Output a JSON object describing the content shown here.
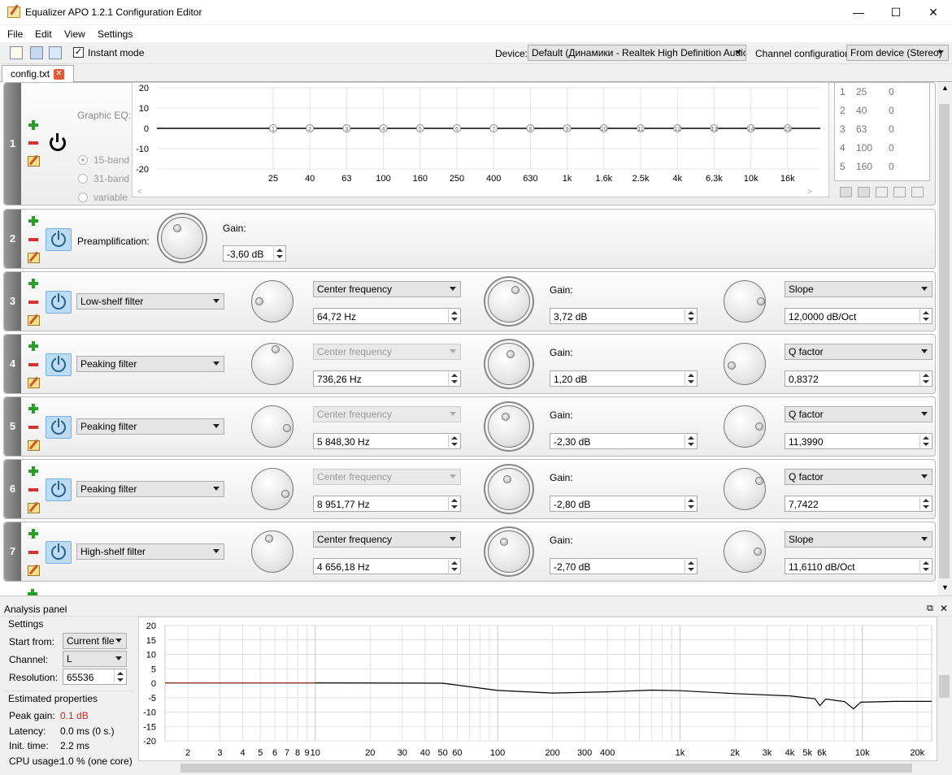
{
  "window": {
    "title": "Equalizer APO 1.2.1 Configuration Editor",
    "minimize": "—",
    "maximize": "☐",
    "close": "✕"
  },
  "menu": [
    "File",
    "Edit",
    "View",
    "Settings"
  ],
  "toolbar": {
    "instant_mode_label": "Instant mode",
    "instant_mode_checked": true,
    "device_label": "Device:",
    "device_value": "Default (Динамики - Realtek High Definition Audio)",
    "channel_label": "Channel configuration:",
    "channel_value": "From device (Stereo)"
  },
  "tab": {
    "label": "config.txt",
    "close": "✕"
  },
  "geq": {
    "number": "1",
    "label": "Graphic EQ:",
    "modes": [
      "15-band",
      "31-band",
      "variable"
    ],
    "selected_mode": "15-band",
    "y_ticks": [
      "20",
      "10",
      "0",
      "-10",
      "-20"
    ],
    "freq_labels": [
      "25",
      "40",
      "63",
      "100",
      "160",
      "250",
      "400",
      "630",
      "1k",
      "1.6k",
      "2.5k",
      "4k",
      "6.3k",
      "10k",
      "16k"
    ],
    "nodes": [
      "1",
      "2",
      "3",
      "4",
      "5",
      "6",
      "7",
      "8",
      "9",
      "10",
      "11",
      "12",
      "13",
      "14",
      "15"
    ],
    "table": [
      [
        "1",
        "25",
        "0"
      ],
      [
        "2",
        "40",
        "0"
      ],
      [
        "3",
        "63",
        "0"
      ],
      [
        "4",
        "100",
        "0"
      ],
      [
        "5",
        "160",
        "0"
      ]
    ]
  },
  "preamp": {
    "number": "2",
    "label": "Preamplification:",
    "gain_label": "Gain:",
    "gain_value": "-3,60 dB"
  },
  "filters": [
    {
      "number": "3",
      "type": "Low-shelf filter",
      "freq_mode": "Center frequency",
      "freq_disabled": false,
      "freq": "64,72 Hz",
      "gain_label": "Gain:",
      "gain": "3,72 dB",
      "q_mode": "Slope",
      "q": "12,0000 dB/Oct"
    },
    {
      "number": "4",
      "type": "Peaking filter",
      "freq_mode": "Center frequency",
      "freq_disabled": true,
      "freq": "736,26 Hz",
      "gain_label": "Gain:",
      "gain": "1,20 dB",
      "q_mode": "Q factor",
      "q": "0,8372"
    },
    {
      "number": "5",
      "type": "Peaking filter",
      "freq_mode": "Center frequency",
      "freq_disabled": true,
      "freq": "5 848,30 Hz",
      "gain_label": "Gain:",
      "gain": "-2,30 dB",
      "q_mode": "Q factor",
      "q": "11,3990"
    },
    {
      "number": "6",
      "type": "Peaking filter",
      "freq_mode": "Center frequency",
      "freq_disabled": true,
      "freq": "8 951,77 Hz",
      "gain_label": "Gain:",
      "gain": "-2,80 dB",
      "q_mode": "Q factor",
      "q": "7,7422"
    },
    {
      "number": "7",
      "type": "High-shelf filter",
      "freq_mode": "Center frequency",
      "freq_disabled": false,
      "freq": "4 656,18 Hz",
      "gain_label": "Gain:",
      "gain": "-2,70 dB",
      "q_mode": "Slope",
      "q": "11,6110 dB/Oct"
    }
  ],
  "analysis": {
    "title": "Analysis panel",
    "settings_title": "Settings",
    "start_from_label": "Start from:",
    "start_from": "Current file",
    "channel_label": "Channel:",
    "channel": "L",
    "resolution_label": "Resolution:",
    "resolution": "65536",
    "estimated_title": "Estimated properties",
    "peak_gain_label": "Peak gain:",
    "peak_gain": "0.1 dB",
    "latency_label": "Latency:",
    "latency": "0.0 ms (0 s.)",
    "init_time_label": "Init. time:",
    "init_time": "2.2 ms",
    "cpu_label": "CPU usage:",
    "cpu": "1.0 % (one core)"
  },
  "chart_data": {
    "type": "line",
    "xscale": "log",
    "xlim": [
      1.5,
      24000
    ],
    "ylim": [
      -20,
      20
    ],
    "y_ticks": [
      "20",
      "15",
      "10",
      "5",
      "0",
      "-5",
      "-10",
      "-15",
      "-20"
    ],
    "x_tick_labels": [
      "2",
      "3",
      "4",
      "5",
      "6",
      "7",
      "8",
      "9",
      "10",
      "20",
      "30",
      "40",
      "50",
      "60",
      "100",
      "200",
      "300",
      "400",
      "1k",
      "2k",
      "3k",
      "4k",
      "5k",
      "6k",
      "10k",
      "20k"
    ],
    "series": [
      {
        "x": [
          1.5,
          10,
          50,
          100,
          200,
          400,
          700,
          1000,
          2000,
          4000,
          5500,
          5850,
          6300,
          8000,
          8950,
          9800,
          15000,
          24000
        ],
        "y": [
          0.1,
          0.1,
          0,
          -2.5,
          -3.4,
          -3,
          -2.4,
          -2.6,
          -3.6,
          -4.4,
          -5.4,
          -7.8,
          -5.5,
          -6.4,
          -8.9,
          -6.6,
          -6.3,
          -6.3
        ]
      }
    ],
    "grid": true
  }
}
